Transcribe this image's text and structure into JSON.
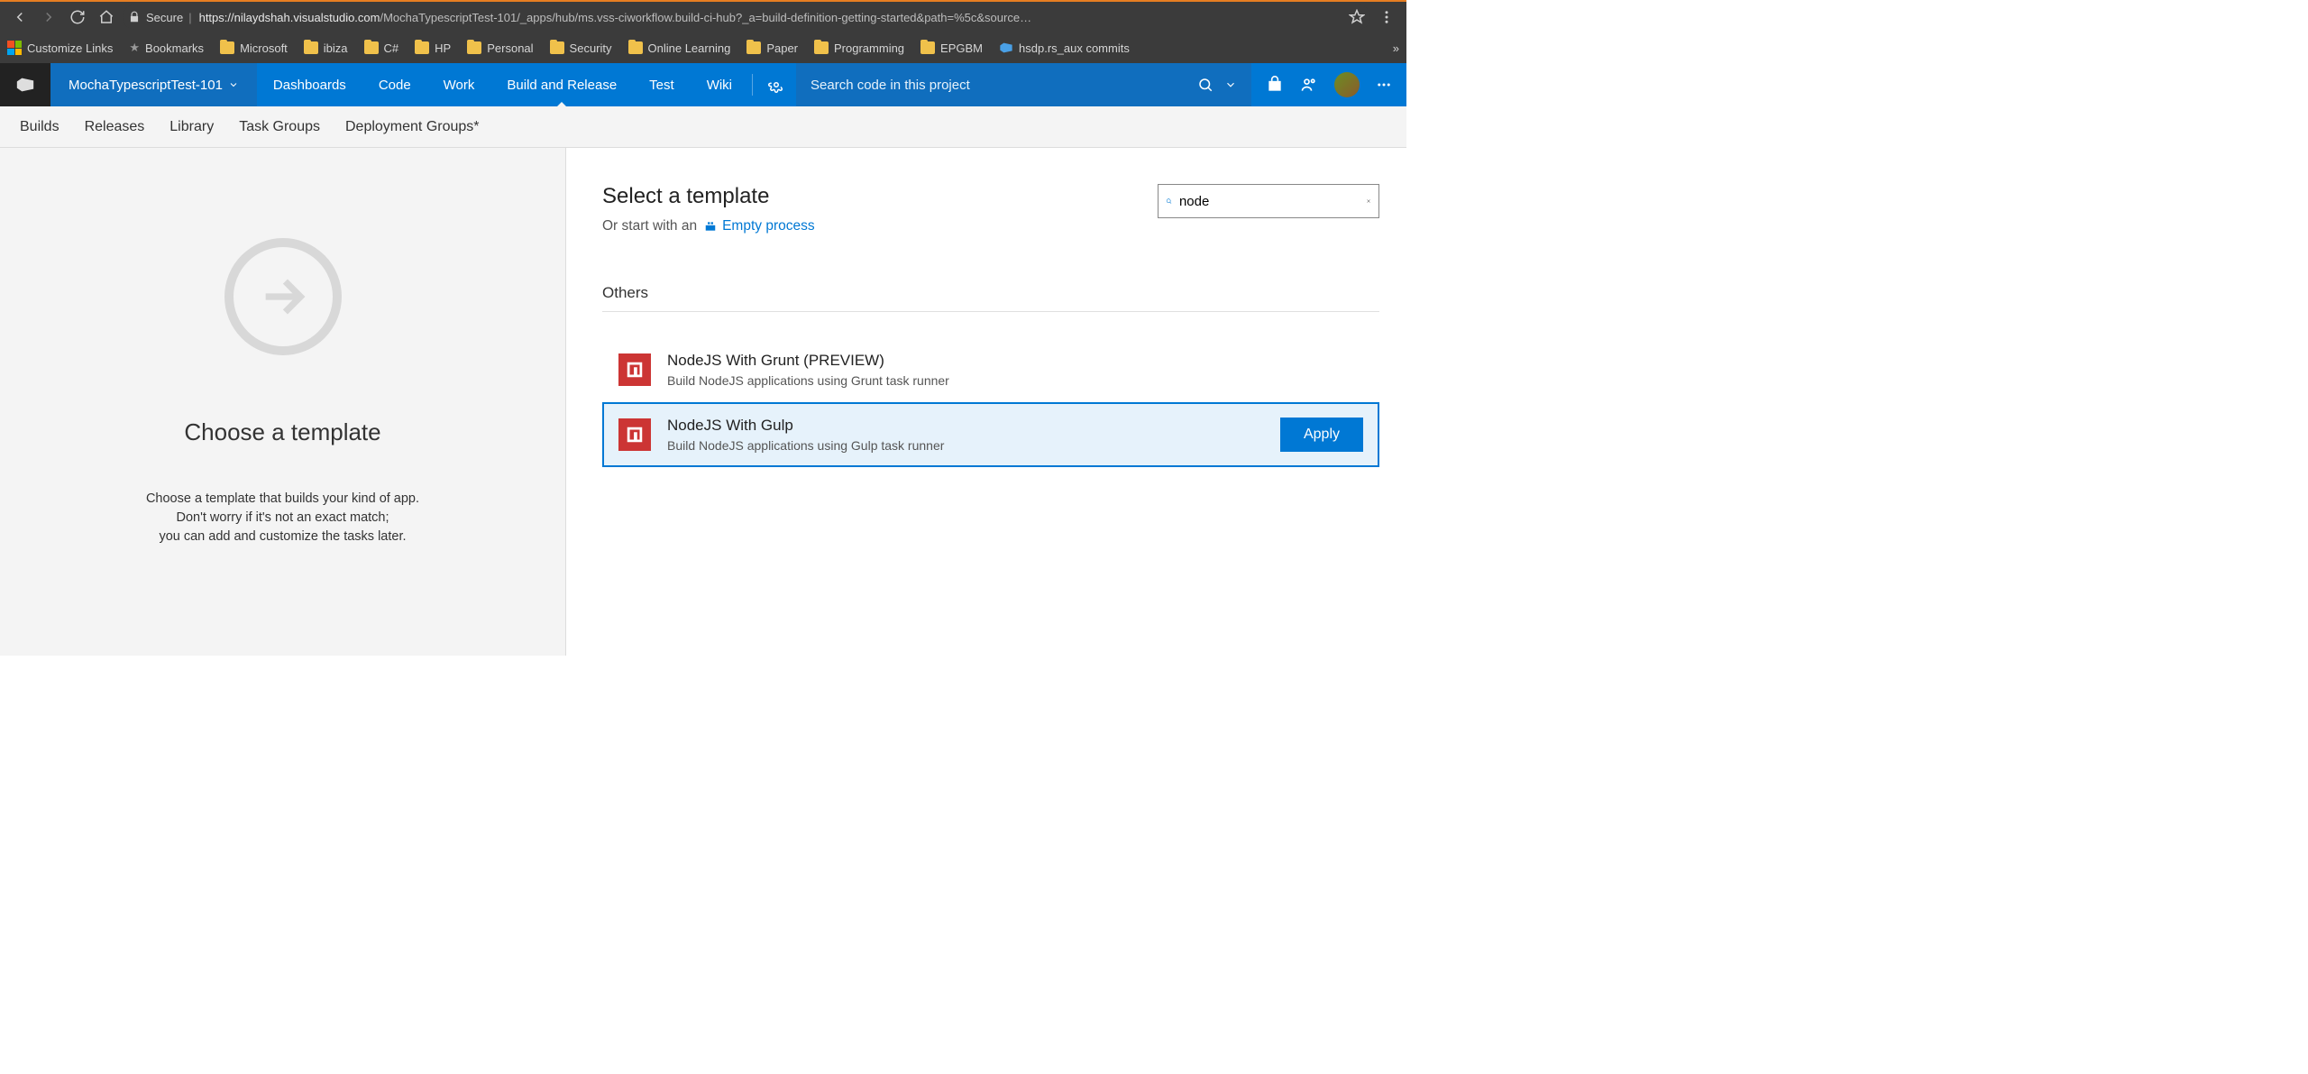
{
  "browser": {
    "secure_label": "Secure",
    "url_host": "https://nilaydshah.visualstudio.com",
    "url_path": "/MochaTypescriptTest-101/_apps/hub/ms.vss-ciworkflow.build-ci-hub?_a=build-definition-getting-started&path=%5c&source…"
  },
  "bookmarks": [
    {
      "label": "Customize Links",
      "type": "win"
    },
    {
      "label": "Bookmarks",
      "type": "star"
    },
    {
      "label": "Microsoft",
      "type": "folder"
    },
    {
      "label": "ibiza",
      "type": "folder"
    },
    {
      "label": "C#",
      "type": "folder"
    },
    {
      "label": "HP",
      "type": "folder"
    },
    {
      "label": "Personal",
      "type": "folder"
    },
    {
      "label": "Security",
      "type": "folder"
    },
    {
      "label": "Online Learning",
      "type": "folder"
    },
    {
      "label": "Paper",
      "type": "folder"
    },
    {
      "label": "Programming",
      "type": "folder"
    },
    {
      "label": "EPGBM",
      "type": "folder"
    },
    {
      "label": "hsdp.rs_aux commits",
      "type": "vsts"
    }
  ],
  "nav": {
    "project": "MochaTypescriptTest-101",
    "items": [
      "Dashboards",
      "Code",
      "Work",
      "Build and Release",
      "Test",
      "Wiki"
    ],
    "active_index": 3,
    "search_placeholder": "Search code in this project"
  },
  "subnav": [
    "Builds",
    "Releases",
    "Library",
    "Task Groups",
    "Deployment Groups*"
  ],
  "left": {
    "title": "Choose a template",
    "line1": "Choose a template that builds your kind of app.",
    "line2": "Don't worry if it's not an exact match;",
    "line3": "you can add and customize the tasks later."
  },
  "right": {
    "title": "Select a template",
    "subtext": "Or start with an",
    "empty_link": "Empty process",
    "search_value": "node",
    "section_label": "Others",
    "templates": [
      {
        "title": "NodeJS With Grunt (PREVIEW)",
        "desc": "Build NodeJS applications using Grunt task runner",
        "selected": false
      },
      {
        "title": "NodeJS With Gulp",
        "desc": "Build NodeJS applications using Gulp task runner",
        "selected": true
      }
    ],
    "apply_label": "Apply"
  }
}
